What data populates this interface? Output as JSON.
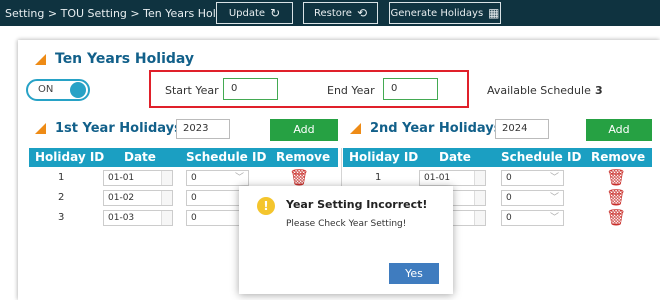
{
  "toolbar": {
    "breadcrumb": "Setting > TOU Setting > Ten Years Holiday",
    "update_label": "Update",
    "restore_label": "Restore",
    "generate_label": "Generate Holidays"
  },
  "panel": {
    "title": "Ten Years Holiday",
    "toggle_label": "ON",
    "start_year_label": "Start Year",
    "start_year_value": "0",
    "end_year_label": "End Year",
    "end_year_value": "0",
    "available_label": "Available Schedule",
    "available_value": "3"
  },
  "first": {
    "title": "1st Year Holidays",
    "year": "2023",
    "add_label": "Add"
  },
  "second": {
    "title": "2nd Year Holidays",
    "year": "2024",
    "add_label": "Add"
  },
  "columns": {
    "holiday_id": "Holiday ID",
    "date": "Date",
    "schedule_id": "Schedule ID",
    "remove": "Remove"
  },
  "first_rows": [
    {
      "id": "1",
      "date": "01-01",
      "schedule": "0"
    },
    {
      "id": "2",
      "date": "01-02",
      "schedule": "0"
    },
    {
      "id": "3",
      "date": "01-03",
      "schedule": "0"
    }
  ],
  "second_rows": [
    {
      "id": "1",
      "date": "01-01",
      "schedule": "0"
    },
    {
      "id": "",
      "date": "",
      "schedule": "0"
    },
    {
      "id": "",
      "date": "",
      "schedule": "0"
    }
  ],
  "dialog": {
    "title": "Year Setting Incorrect!",
    "message": "Please Check Year Setting!",
    "yes_label": "Yes"
  },
  "colors": {
    "topbar": "#0f3340",
    "accent": "#1b9fc2",
    "add": "#26a143",
    "warning_border": "#e0202a"
  }
}
